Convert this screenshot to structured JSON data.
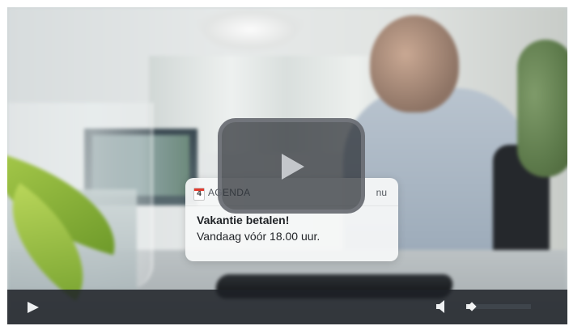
{
  "notification": {
    "app_icon_day": "4",
    "app_name": "AGENDA",
    "time": "nu",
    "title": "Vakantie betalen!",
    "body": "Vandaag vóór 18.00 uur."
  },
  "player": {
    "big_play_icon": "play-icon",
    "control_play_icon": "play-icon",
    "volume_icon": "speaker-icon",
    "volume_level": 0.05
  },
  "colors": {
    "control_bar": "#1e2228",
    "big_play_bg": "#282c32",
    "notification_bg": "#f6f7f8"
  }
}
